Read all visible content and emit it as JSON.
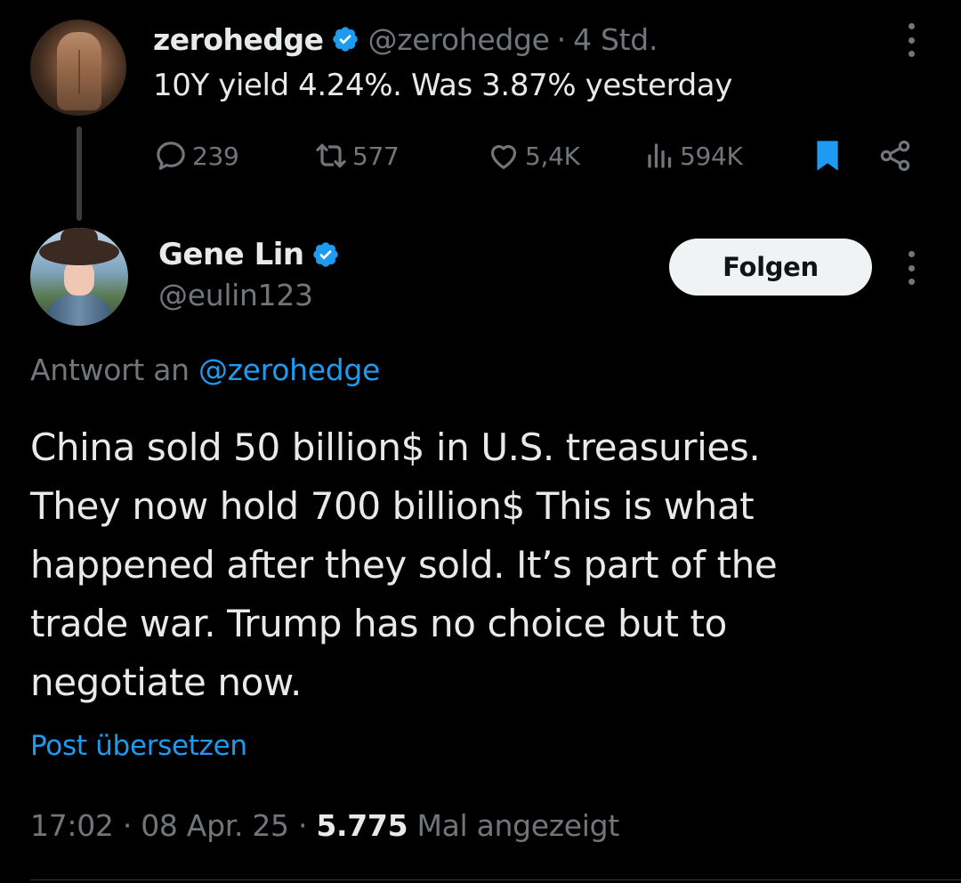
{
  "colors": {
    "background": "#000000",
    "text_primary": "#e7e9ea",
    "text_secondary": "#71767b",
    "accent_blue": "#1d9bf0",
    "follow_button_bg": "#eff3f4"
  },
  "parent_tweet": {
    "author_name": "zerohedge",
    "verified_icon": "verified-badge-icon",
    "handle": "@zerohedge",
    "separator": "·",
    "time": "4 Std.",
    "text": "10Y yield 4.24%. Was 3.87% yesterday",
    "actions": {
      "replies": "239",
      "reposts": "577",
      "likes": "5,4K",
      "views": "594K"
    },
    "bookmarked": true
  },
  "reply_tweet": {
    "author_name": "Gene Lin",
    "verified_icon": "verified-badge-icon",
    "handle": "@eulin123",
    "follow_label": "Folgen",
    "reply_to_prefix": "Antwort an",
    "reply_to_handle": "@zerohedge",
    "text_lines": [
      "China sold 50 billion$ in U.S. treasuries.",
      "They now hold 700 billion$ This is what",
      "happened after they sold. It’s part of the",
      "trade war. Trump has no choice but to",
      "negotiate now."
    ],
    "translate_label": "Post übersetzen",
    "meta": {
      "time": "17:02",
      "separator": "·",
      "date": "08 Apr. 25",
      "views_count": "5.775",
      "views_label": "Mal angezeigt"
    }
  }
}
